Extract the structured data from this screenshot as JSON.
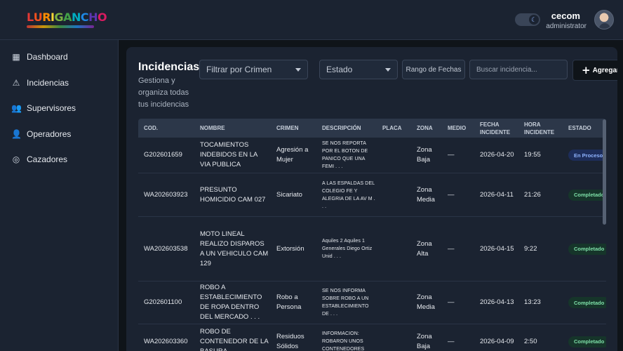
{
  "app": {
    "logo_text": "LURIGANCHO",
    "theme_toggle_icon": "moon-icon",
    "user_name": "cecom",
    "user_role": "administrator"
  },
  "sidebar": {
    "items": [
      {
        "label": "Dashboard",
        "icon": "dashboard-icon",
        "glyph": "▦"
      },
      {
        "label": "Incidencias",
        "icon": "warning-icon",
        "glyph": "⚠"
      },
      {
        "label": "Supervisores",
        "icon": "group-icon",
        "glyph": "👥"
      },
      {
        "label": "Operadores",
        "icon": "user-gear-icon",
        "glyph": "👤"
      },
      {
        "label": "Cazadores",
        "icon": "target-icon",
        "glyph": "◎"
      }
    ]
  },
  "page": {
    "title": "Incidencias",
    "subtitle": "Gestiona y organiza todas tus incidencias"
  },
  "filters": {
    "crime_placeholder": "Filtrar por Crimen",
    "state_placeholder": "Estado",
    "date_range_label": "Rango de Fechas",
    "search_placeholder": "Buscar incidencia...",
    "add_label": "Agregar"
  },
  "table": {
    "columns": [
      "COD.",
      "NOMBRE",
      "CRIMEN",
      "DESCRIPCIÓN",
      "PLACA",
      "ZONA",
      "MEDIO",
      "FECHA INCIDENTE",
      "HORA INCIDENTE",
      "ESTADO"
    ],
    "rows": [
      {
        "cod": "G202601659",
        "nombre": "TOCAMIENTOS INDEBIDOS EN LA VIA PUBLICA",
        "crimen": "Agresión a Mujer",
        "descripcion": "SE NOS REPORTA POR EL BOTON DE PANICO QUE UNA FEMI . . .",
        "placa": "",
        "zona": "Zona Baja",
        "medio": "—",
        "fecha": "2026-04-20",
        "hora": "19:55",
        "estado": "En Proceso",
        "estado_tipo": "proc"
      },
      {
        "cod": "WA202603923",
        "nombre": "PRESUNTO HOMICIDIO CAM 027",
        "crimen": "Sicariato",
        "descripcion": "A LAS ESPALDAS DEL COLEGIO FE Y ALEGRIA DE LA AV M . . .",
        "placa": "",
        "zona": "Zona Media",
        "medio": "—",
        "fecha": "2026-04-11",
        "hora": "21:26",
        "estado": "Completado",
        "estado_tipo": "done"
      },
      {
        "cod": "WA202603538",
        "nombre": "MOTO LINEAL REALIZO DISPAROS A UN VEHICULO CAM 129",
        "crimen": "Extorsión",
        "descripcion": "Aquiles 2 Aquiles 1 Generales Diego Ortiz Unid . . .",
        "placa": "",
        "zona": "Zona Alta",
        "medio": "—",
        "fecha": "2026-04-15",
        "hora": "9:22",
        "estado": "Completado",
        "estado_tipo": "done"
      },
      {
        "cod": "G202601100",
        "nombre": "ROBO A ESTABLECIMIENTO DE ROPA DENTRO DEL MERCADO . . .",
        "crimen": "Robo a Persona",
        "descripcion": "SE NOS INFORMA SOBRE ROBO A UN ESTABLECIMIENTO DE . . .",
        "placa": "",
        "zona": "Zona Media",
        "medio": "—",
        "fecha": "2026-04-13",
        "hora": "13:23",
        "estado": "Completado",
        "estado_tipo": "done"
      },
      {
        "cod": "WA202603360",
        "nombre": "ROBO DE CONTENEDOR DE LA BASURA",
        "crimen": "Residuos Sólidos",
        "descripcion": "INFORMACION: ROBARON UNOS CONTENEDORES",
        "placa": "",
        "zona": "Zona Baja",
        "medio": "—",
        "fecha": "2026-04-09",
        "hora": "2:50",
        "estado": "Completado",
        "estado_tipo": "done"
      }
    ]
  },
  "colors": {
    "background": "#0f1419",
    "panel": "#1b2331",
    "header_row": "#2c3749",
    "badge_process_bg": "#1d2d5a",
    "badge_done_bg": "#16352a",
    "badge_done_text": "#7ee0a8"
  }
}
